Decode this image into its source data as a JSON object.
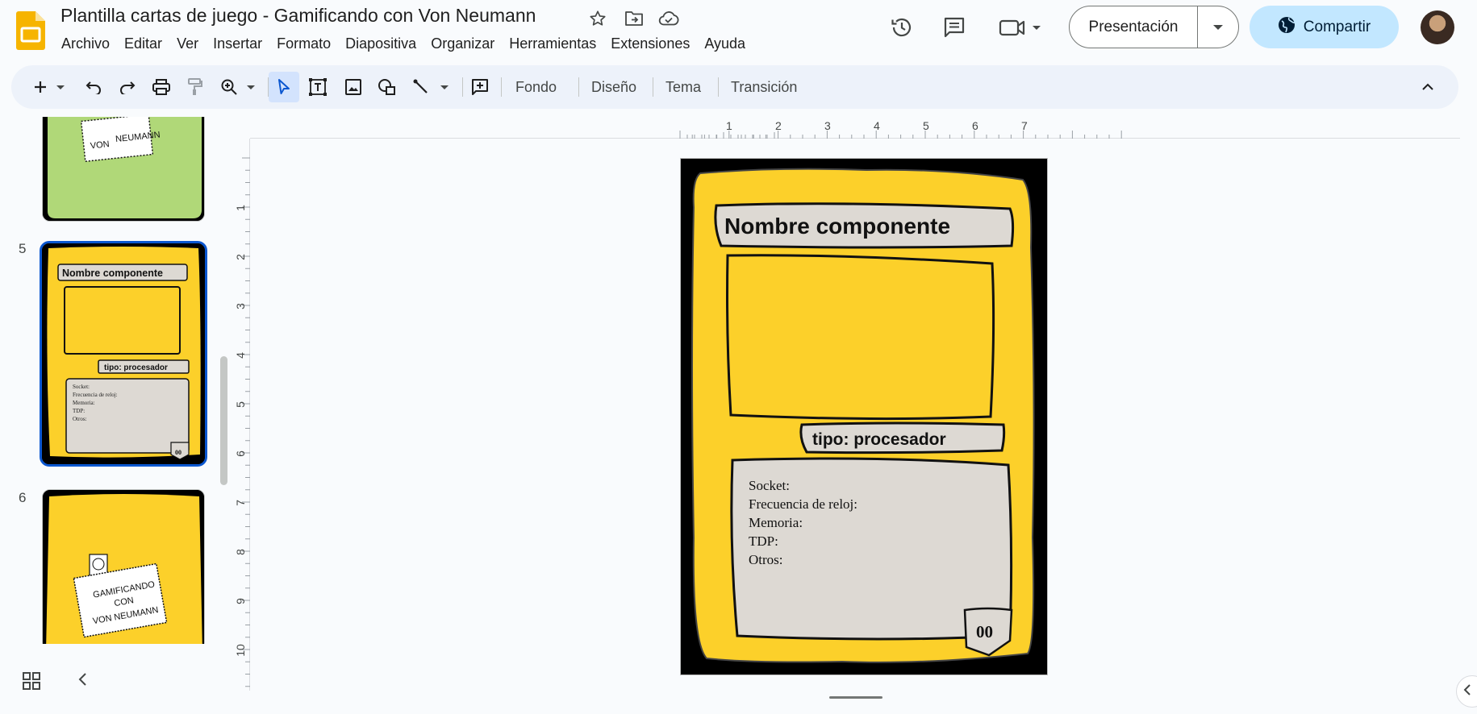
{
  "app": {
    "doc_title": "Plantilla cartas de juego - Gamificando con Von Neumann"
  },
  "menu": [
    "Archivo",
    "Editar",
    "Ver",
    "Insertar",
    "Formato",
    "Diapositiva",
    "Organizar",
    "Herramientas",
    "Extensiones",
    "Ayuda"
  ],
  "header_actions": {
    "present_label": "Presentación",
    "share_label": "Compartir"
  },
  "toolbar": {
    "background_label": "Fondo",
    "layout_label": "Diseño",
    "theme_label": "Tema",
    "transition_label": "Transición"
  },
  "filmstrip": {
    "slides": [
      {
        "number": "5",
        "title": "Nombre componente",
        "type": "tipo: procesador",
        "fields": [
          "Socket:",
          "Frecuencia de reloj:",
          "Memoria:",
          "TDP:",
          "Otros:"
        ],
        "badge": "00"
      },
      {
        "number": "6",
        "logo_text": [
          "GAMIFICANDO",
          "CON",
          "VON NEUMANN"
        ]
      }
    ],
    "partial_logo_text": [
      "VON",
      "NEUMANN"
    ]
  },
  "ruler": {
    "horizontal": [
      "1",
      "2",
      "3",
      "4",
      "5",
      "6",
      "7"
    ],
    "vertical": [
      "1",
      "2",
      "3",
      "4",
      "5",
      "6",
      "7",
      "8",
      "9",
      "10"
    ]
  },
  "card": {
    "title": "Nombre componente",
    "type": "tipo: procesador",
    "fields": [
      "Socket:",
      "Frecuencia de reloj:",
      "Memoria:",
      "TDP:",
      "Otros:"
    ],
    "badge": "00"
  },
  "colors": {
    "card_yellow": "#fcd02a",
    "card_green": "#b0d878",
    "panel_gray": "#ddd9d3",
    "selected_border": "#0b57d0",
    "share_bg": "#c2e7ff",
    "logo_yellow": "#f6b400"
  }
}
